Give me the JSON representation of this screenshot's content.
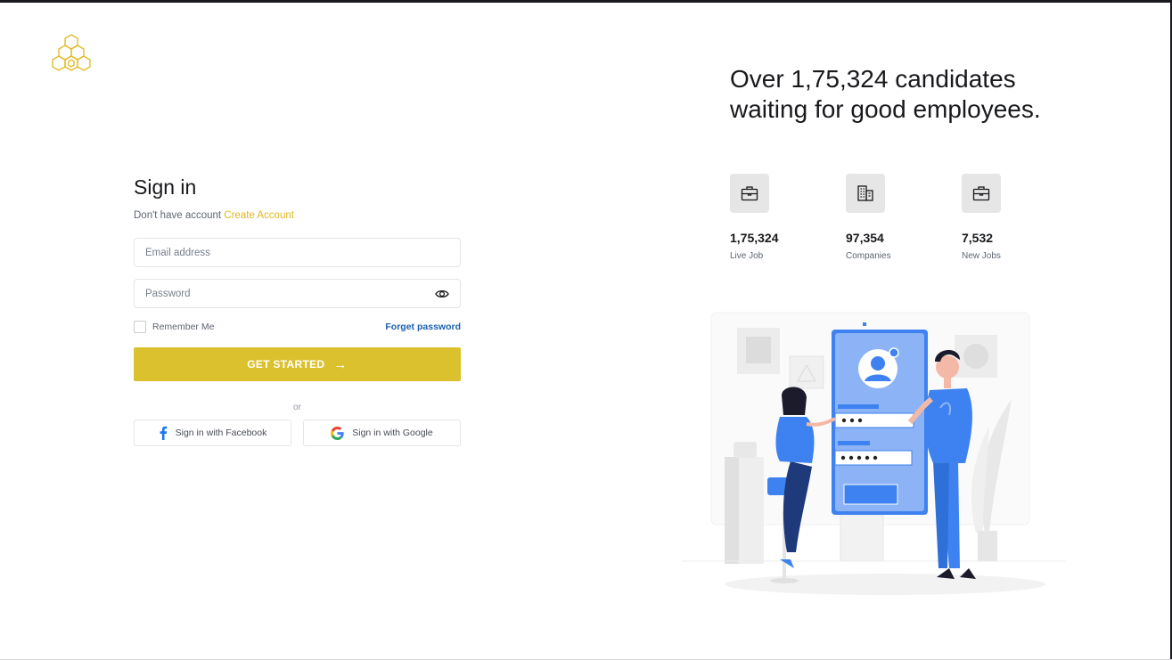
{
  "signin": {
    "title": "Sign in",
    "no_account_text": "Don't have account",
    "create_account_label": "Create Account",
    "email_placeholder": "Email address",
    "password_placeholder": "Password",
    "remember_label": "Remember Me",
    "forget_label": "Forget password",
    "cta_label": "GET STARTED",
    "cta_icon": "arrow-right-icon",
    "or_label": "or",
    "facebook_label": "Sign in with Facebook",
    "google_label": "Sign in with Google"
  },
  "hero": {
    "headline_line1": "Over 1,75,324 candidates",
    "headline_line2": "waiting for good employees."
  },
  "stats": [
    {
      "icon": "briefcase-icon",
      "value": "1,75,324",
      "label": "Live Job"
    },
    {
      "icon": "building-icon",
      "value": "97,354",
      "label": "Companies"
    },
    {
      "icon": "briefcase-icon",
      "value": "7,532",
      "label": "New Jobs"
    }
  ],
  "colors": {
    "accent": "#dcc12f",
    "link_yellow": "#e0b820",
    "link_blue": "#1b5fb0",
    "illustration_blue": "#3d82f0",
    "stat_icon_bg": "#e6e6e6"
  }
}
